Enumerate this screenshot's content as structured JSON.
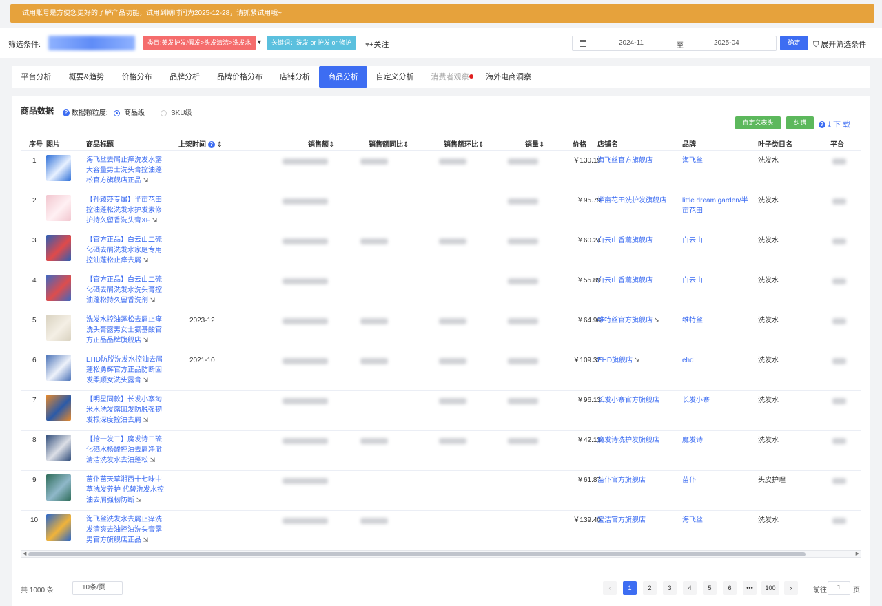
{
  "banner": {
    "text": "试用账号是方便您更好的了解产品功能，试用到期时间为2025-12-28，请抓紧试用哦~"
  },
  "filters": {
    "label": "筛选条件:",
    "category_tag": "类目:美发护发/假发>头发清洁>洗发水",
    "keyword_tag": "关键词：洗发 or 护发 or 修护",
    "follow": "+关注",
    "date_from": "2024-11",
    "date_sep": "至",
    "date_to": "2025-04",
    "confirm": "确定",
    "expand": "展开筛选条件"
  },
  "tabs": [
    "平台分析",
    "概要&趋势",
    "价格分布",
    "品牌分析",
    "品牌价格分布",
    "店铺分析",
    "商品分析",
    "自定义分析",
    "消费者观察",
    "海外电商洞察"
  ],
  "active_tab": "商品分析",
  "panel": {
    "title": "商品数据",
    "granularity_label": "数据颗粒度:",
    "option_product": "商品级",
    "option_sku": "SKU级",
    "btn_custom_header": "自定义表头",
    "btn_correct": "纠错",
    "download": "下 载"
  },
  "columns": {
    "idx": "序号",
    "img": "图片",
    "title": "商品标题",
    "launch": "上架时间",
    "sales": "销售额",
    "yoy": "销售额同比",
    "mom": "销售额环比",
    "volume": "销量",
    "price": "价格",
    "shop": "店铺名",
    "brand": "品牌",
    "leaf": "叶子类目名",
    "platform": "平台"
  },
  "rows": [
    {
      "idx": "1",
      "title": "海飞丝去屑止痒洗发水露大容量男士洗头膏控油蓬松官方旗舰店正品",
      "launch": "",
      "price": "￥130.19",
      "shop": "海飞丝官方旗舰店",
      "shop_ext": false,
      "brand": "海飞丝",
      "leaf": "洗发水"
    },
    {
      "idx": "2",
      "title": "【孙颖莎专属】半亩花田控油蓬松洗发水护发素修护持久留香洗头膏XF",
      "launch": "",
      "price": "￥95.79",
      "shop": "半亩花田洗护发旗舰店",
      "shop_ext": false,
      "brand": "little dream garden/半亩花田",
      "leaf": "洗发水"
    },
    {
      "idx": "3",
      "title": "【官方正品】白云山二硫化硒去屑洗发水家庭专用控油蓬松止痒去屑",
      "launch": "",
      "price": "￥60.24",
      "shop": "白云山香薰旗舰店",
      "shop_ext": false,
      "brand": "白云山",
      "leaf": "洗发水"
    },
    {
      "idx": "4",
      "title": "【官方正品】白云山二硫化硒去屑洗发水洗头膏控油蓬松持久留香洗剂",
      "launch": "",
      "price": "￥55.89",
      "shop": "白云山香薰旗舰店",
      "shop_ext": false,
      "brand": "白云山",
      "leaf": "洗发水"
    },
    {
      "idx": "5",
      "title": "洗发水控油蓬松去屑止痒洗头膏露男女士氨基酸官方正品品牌旗舰店",
      "launch": "2023-12",
      "price": "￥64.96",
      "shop": "维特丝官方旗舰店",
      "shop_ext": true,
      "brand": "维特丝",
      "leaf": "洗发水"
    },
    {
      "idx": "6",
      "title": "EHD防脱洗发水控油去屑蓬松勇辉官方正品防断固发柔顺女洗头露膏",
      "launch": "2021-10",
      "price": "￥109.32",
      "shop": "EHD旗舰店",
      "shop_ext": true,
      "brand": "ehd",
      "leaf": "洗发水"
    },
    {
      "idx": "7",
      "title": "【明星同款】长发小寨淘米水洗发露固发防脱强韧发根深度控油去屑",
      "launch": "",
      "price": "￥96.13",
      "shop": "长发小寨官方旗舰店",
      "shop_ext": false,
      "brand": "长发小寨",
      "leaf": "洗发水"
    },
    {
      "idx": "8",
      "title": "【抢一发二】魔发诗二硫化硒水杨酸控油去屑净澈清洁洗发水去油蓬松",
      "launch": "",
      "price": "￥42.13",
      "shop": "魔发诗洗护发旗舰店",
      "shop_ext": false,
      "brand": "魔发诗",
      "leaf": "洗发水"
    },
    {
      "idx": "9",
      "title": "苗仆苗天草湘西十七味中草洗发养护 代替洗发水控油去屑强韧防断",
      "launch": "",
      "price": "￥61.87",
      "shop": "苗仆官方旗舰店",
      "shop_ext": false,
      "brand": "苗仆",
      "leaf": "头皮护理"
    },
    {
      "idx": "10",
      "title": "海飞丝洗发水去屑止痒洗发清爽去油控油洗头膏露男官方旗舰店正品",
      "launch": "",
      "price": "￥139.40",
      "shop": "宝洁官方旗舰店",
      "shop_ext": false,
      "brand": "海飞丝",
      "leaf": "洗发水"
    }
  ],
  "pagination": {
    "total": "共 1000 条",
    "page_size": "10条/页",
    "pages": [
      "1",
      "2",
      "3",
      "4",
      "5",
      "6",
      "•••",
      "100"
    ],
    "current": "1",
    "goto_label": "前往",
    "goto_value": "1",
    "goto_unit": "页"
  }
}
